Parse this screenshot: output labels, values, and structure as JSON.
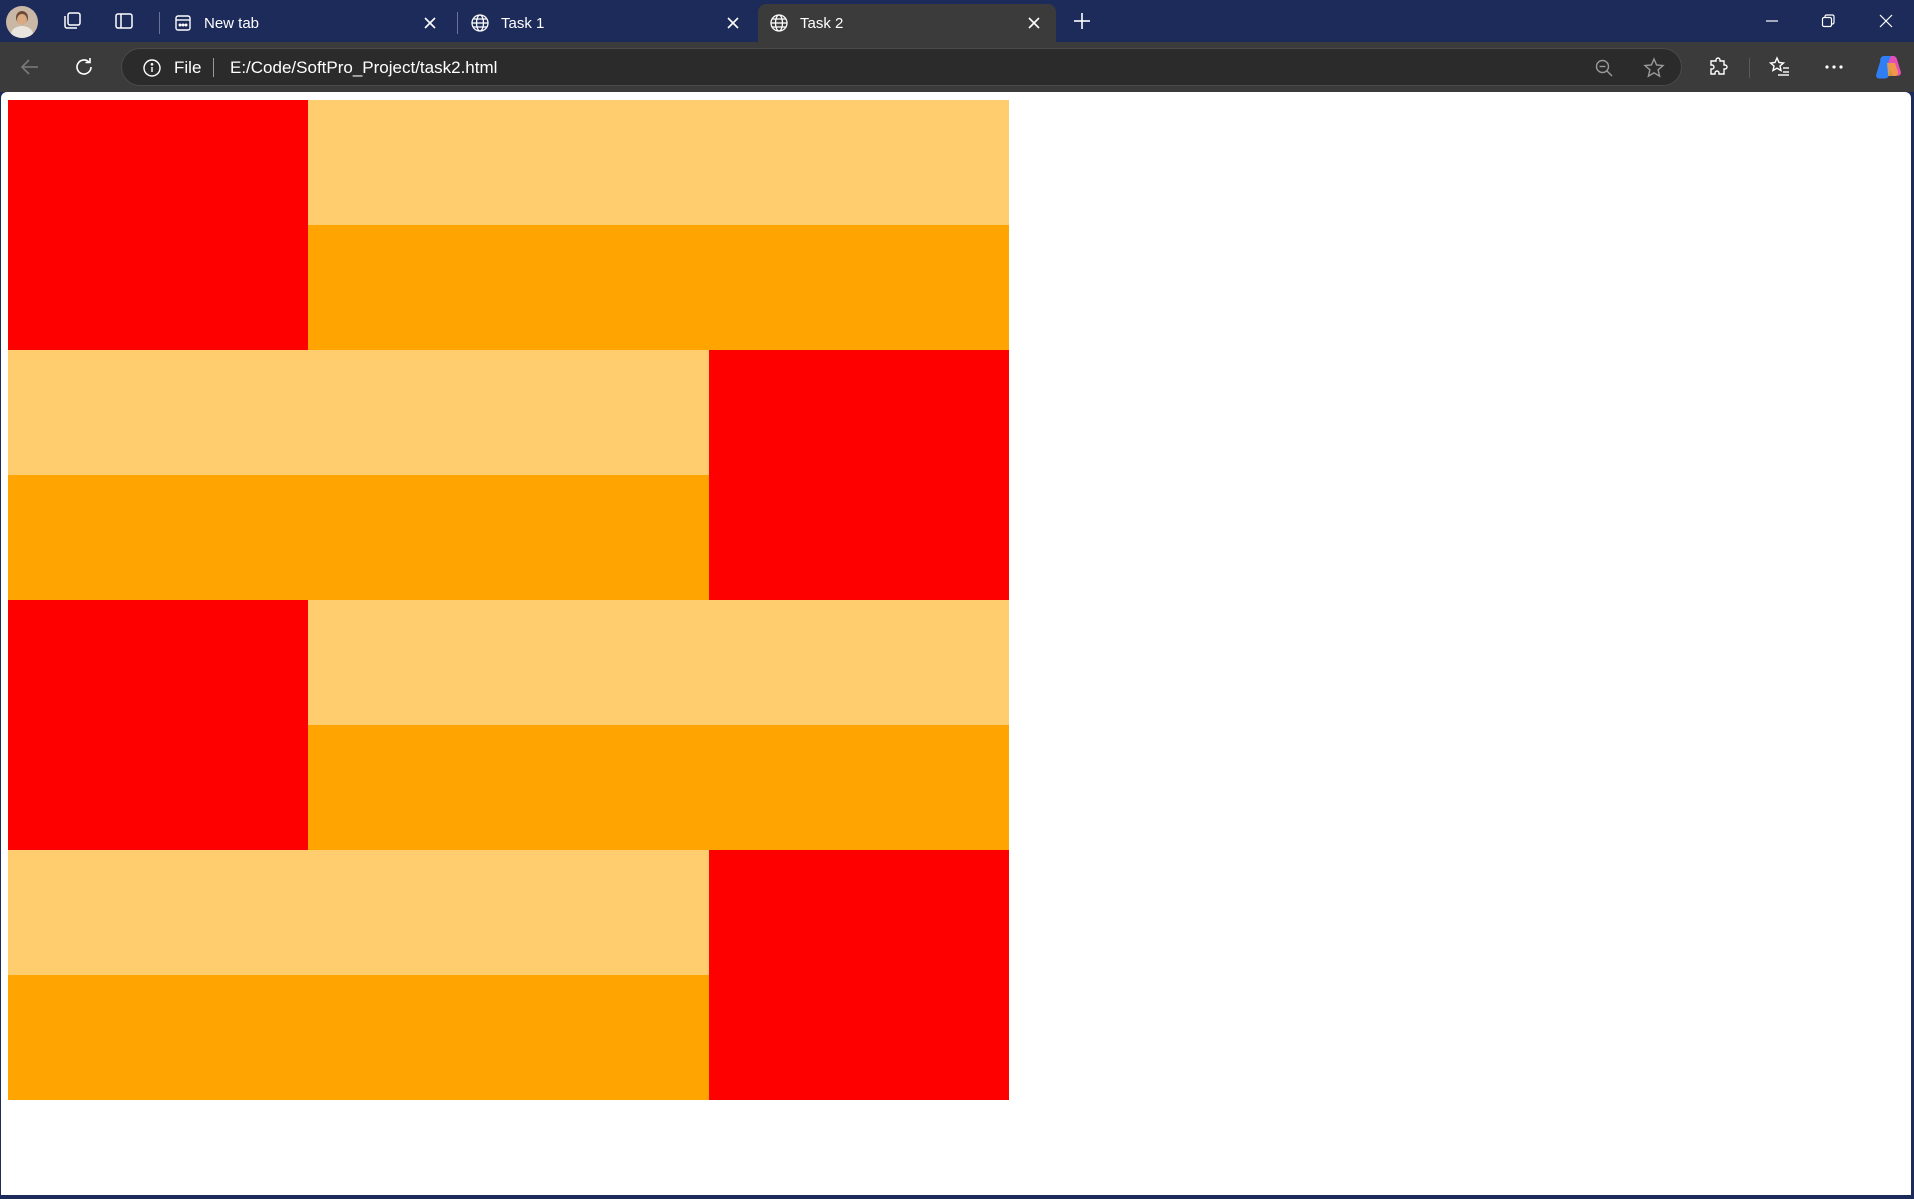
{
  "browser": {
    "tabs": [
      {
        "title": "New tab",
        "icon": "new-tab-page-icon",
        "active": false
      },
      {
        "title": "Task 1",
        "icon": "globe-icon",
        "active": false
      },
      {
        "title": "Task 2",
        "icon": "globe-icon",
        "active": true
      }
    ],
    "address": {
      "scheme_label": "File",
      "url": "E:/Code/SoftPro_Project/task2.html"
    },
    "colors": {
      "tabstrip": "#1c2b5a",
      "toolbar": "#3b3b3b",
      "active_tab": "#3b3b3b"
    }
  },
  "page": {
    "colors": {
      "red": "#ff0000",
      "light_orange": "#ffcc6e",
      "orange": "#ffa400"
    },
    "blocks": [
      {
        "red_side": "left"
      },
      {
        "red_side": "right"
      },
      {
        "red_side": "left"
      },
      {
        "red_side": "right"
      }
    ]
  }
}
